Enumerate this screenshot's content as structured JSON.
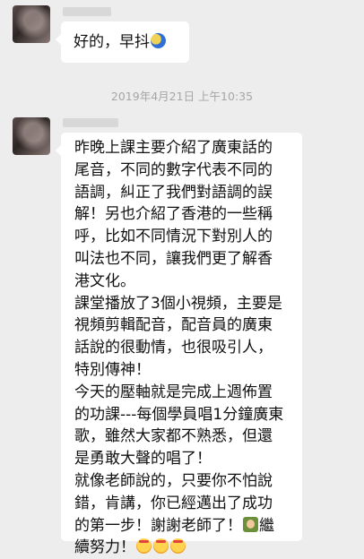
{
  "message_1": {
    "text": "好的，早抖"
  },
  "timestamp": "2019年4月21日 上午10:35",
  "message_2": {
    "lines": [
      "昨晚上課主要介紹了廣東話的",
      "尾音，不同的數字代表不同的",
      "語調，糾正了我們對語調的誤",
      "解！另也介紹了香港的一些稱",
      "呼，比如不同情況下對別人的",
      "叫法也不同，讓我們更了解香",
      "港文化。",
      "課堂播放了3個小視頻，主要是",
      "視頻剪輯配音，配音員的廣東",
      "話說的很動情，也很吸引人，",
      "特別傳神！",
      "今天的壓軸就是完成上週佈置",
      "的功課---每個學員唱1分鐘廣東",
      "歌，雖然大家都不熟悉，但還",
      "是勇敢大聲的唱了！",
      "就像老師說的，只要你不怕說",
      "錯，肯講，你已經邁出了成功",
      "的第一步！謝謝老師了！"
    ],
    "last_line_after_icon": "繼",
    "final_line": "續努力！",
    "icons": [
      "crescent-moon-emoji",
      "teacher-emoji",
      "headband-face-emoji"
    ]
  }
}
